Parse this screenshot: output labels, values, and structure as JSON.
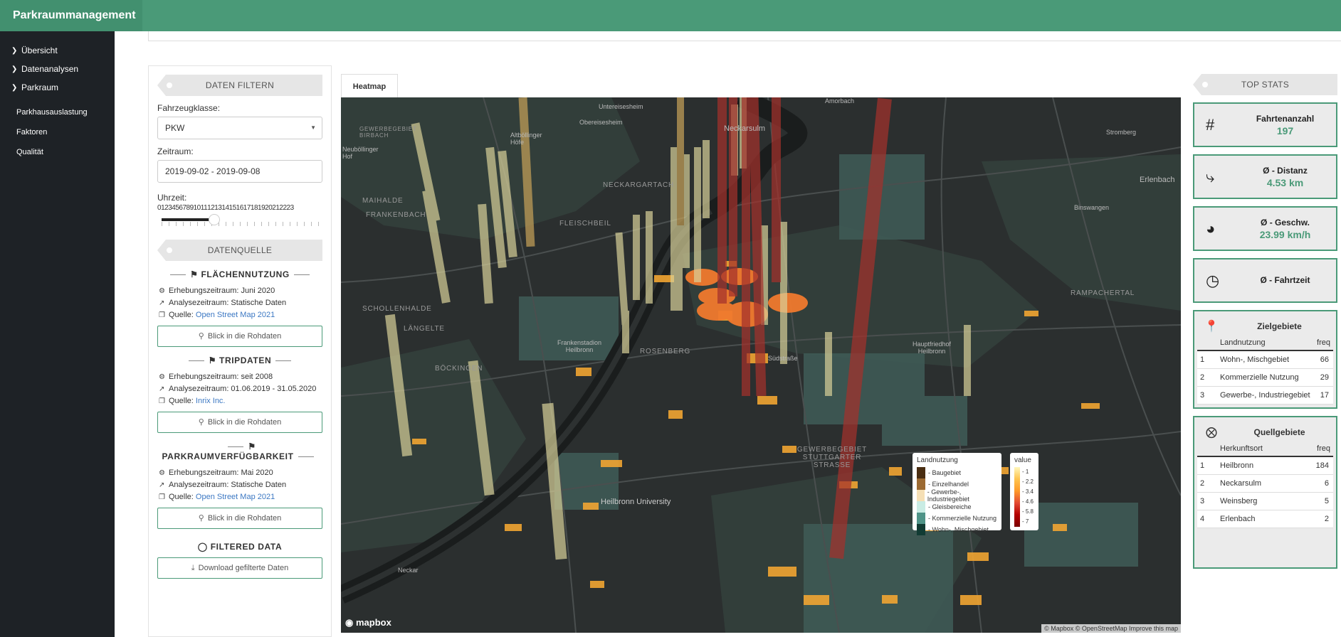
{
  "app": {
    "title": "Parkraummanagement"
  },
  "sidebar": {
    "items": [
      {
        "label": "Übersicht"
      },
      {
        "label": "Datenanalysen"
      },
      {
        "label": "Parkraum"
      }
    ],
    "subitems": [
      {
        "label": "Parkhausauslastung"
      },
      {
        "label": "Faktoren"
      },
      {
        "label": "Qualität"
      }
    ]
  },
  "filter": {
    "header": "DATEN FILTERN",
    "vehicle_label": "Fahrzeugklasse:",
    "vehicle_value": "PKW",
    "period_label": "Zeitraum:",
    "period_value": "2019-09-02 - 2019-09-08",
    "time_label": "Uhrzeit:",
    "time_ticks": [
      "0",
      "1",
      "2",
      "3",
      "4",
      "5",
      "6",
      "7",
      "8",
      "9",
      "10",
      "11",
      "12",
      "13",
      "14",
      "15",
      "16",
      "17",
      "18",
      "19",
      "20",
      "21",
      "22",
      "23"
    ],
    "time_selected": [
      0,
      7
    ]
  },
  "sources": {
    "header": "DATENQUELLE",
    "sections": [
      {
        "title": "FLÄCHENNUTZUNG",
        "survey": "Erhebungszeitraum: Juni 2020",
        "analysis": "Analysezeitraum: Statische Daten",
        "source_prefix": "Quelle: ",
        "source_link": "Open Street Map 2021",
        "button": "Blick in die Rohdaten"
      },
      {
        "title": "TRIPDATEN",
        "survey": "Erhebungszeitraum: seit 2008",
        "analysis": "Analysezeitraum: 01.06.2019 - 31.05.2020",
        "source_prefix": "Quelle: ",
        "source_link": "Inrix Inc.",
        "button": "Blick in die Rohdaten"
      },
      {
        "title": "PARKRAUMVERFÜGBARKEIT",
        "survey": "Erhebungszeitraum: Mai 2020",
        "analysis": "Analysezeitraum: Statische Daten",
        "source_prefix": "Quelle: ",
        "source_link": "Open Street Map 2021",
        "button": "Blick in die Rohdaten"
      }
    ],
    "filtered_title": "FILTERED DATA",
    "download_button": "Download gefilterte Daten"
  },
  "map": {
    "tab": "Heatmap",
    "logo": "mapbox",
    "attribution": "© Mapbox © OpenStreetMap  Improve this map",
    "labels": [
      "Untereisesheim",
      "Obereisesheim",
      "Altböllinger Höfe",
      "Neuböllinger Hof",
      "GEWERBEGEBIET BIRBACH",
      "Neckarsulm",
      "Amorbach",
      "NECKARGARTACH",
      "MAIHALDE",
      "FRANKENBACH",
      "FLEISCHBEIL",
      "SCHOLLENHALDE",
      "LÄNGELTE",
      "BÖCKINGEN",
      "ROSENBERG",
      "Frankenstadion Heilbronn",
      "Hauptfriedhof Heilbronn",
      "RAMPACHERTAL",
      "GEWERBEGEBIET STUTTGARTER STRASSE",
      "Heilbronn University",
      "Erlenbach",
      "Binswangen",
      "Stromberg",
      "Südstraße",
      "Neckar"
    ],
    "legend_landuse": {
      "title": "Landnutzung",
      "items": [
        {
          "label": "- Baugebiet",
          "color": "#4a2e12"
        },
        {
          "label": "- Einzelhandel",
          "color": "#9c6a32"
        },
        {
          "label": "- Gewerbe-, Industriegebiet",
          "color": "#f5dfb5"
        },
        {
          "label": "- Gleisbereiche",
          "color": "#c9ece4"
        },
        {
          "label": "- Kommerzielle Nutzung",
          "color": "#4f9488"
        },
        {
          "label": "- Wohn-, Mischgebiet",
          "color": "#113b33"
        }
      ]
    },
    "legend_value": {
      "title": "value",
      "ticks": [
        "- 1",
        "- 2.2",
        "- 3.4",
        "- 4.6",
        "- 5.8",
        "- 7"
      ]
    }
  },
  "stats": {
    "header": "TOP STATS",
    "cards": [
      {
        "label": "Fahrtenanzahl",
        "value": "197",
        "icon": "hash-icon"
      },
      {
        "label": "Ø - Distanz",
        "value": "4.53 km",
        "icon": "route-icon"
      },
      {
        "label": "Ø - Geschw.",
        "value": "23.99 km/h",
        "icon": "speedometer-icon"
      },
      {
        "label": "Ø - Fahrtzeit",
        "value": "",
        "icon": "clock-icon"
      }
    ],
    "ziel": {
      "title": "Zielgebiete",
      "col1": "Landnutzung",
      "col2": "freq",
      "rows": [
        {
          "n": "1",
          "name": "Wohn-, Mischgebiet",
          "freq": "66"
        },
        {
          "n": "2",
          "name": "Kommerzielle Nutzung",
          "freq": "29"
        },
        {
          "n": "3",
          "name": "Gewerbe-, Industriegebiet",
          "freq": "17"
        }
      ]
    },
    "quell": {
      "title": "Quellgebiete",
      "col1": "Herkunftsort",
      "col2": "freq",
      "rows": [
        {
          "n": "1",
          "name": "Heilbronn",
          "freq": "184"
        },
        {
          "n": "2",
          "name": "Neckarsulm",
          "freq": "6"
        },
        {
          "n": "3",
          "name": "Weinsberg",
          "freq": "5"
        },
        {
          "n": "4",
          "name": "Erlenbach",
          "freq": "2"
        }
      ]
    }
  }
}
